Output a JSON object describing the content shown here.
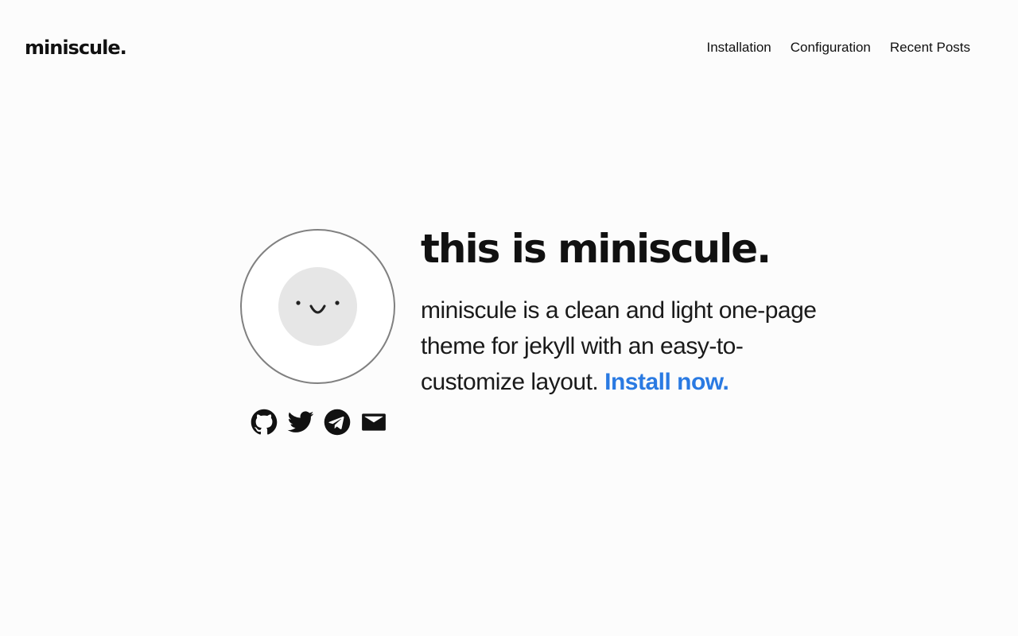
{
  "header": {
    "logo": "miniscule.",
    "nav": [
      {
        "label": "Installation"
      },
      {
        "label": "Configuration"
      },
      {
        "label": "Recent Posts"
      }
    ]
  },
  "hero": {
    "title": "this is miniscule.",
    "description": "miniscule is a clean and light one-page theme for jekyll with an easy-to-customize layout.",
    "cta_label": "Install now.",
    "avatar_icon": "smiley-face-icon"
  },
  "socials": [
    {
      "icon": "github-icon"
    },
    {
      "icon": "twitter-icon"
    },
    {
      "icon": "telegram-icon"
    },
    {
      "icon": "mail-icon"
    }
  ],
  "colors": {
    "background": "#fcfcfc",
    "text": "#111111",
    "link_accent": "#2a7ae2",
    "avatar_ring": "#808080",
    "avatar_face": "#e6e6e6"
  }
}
